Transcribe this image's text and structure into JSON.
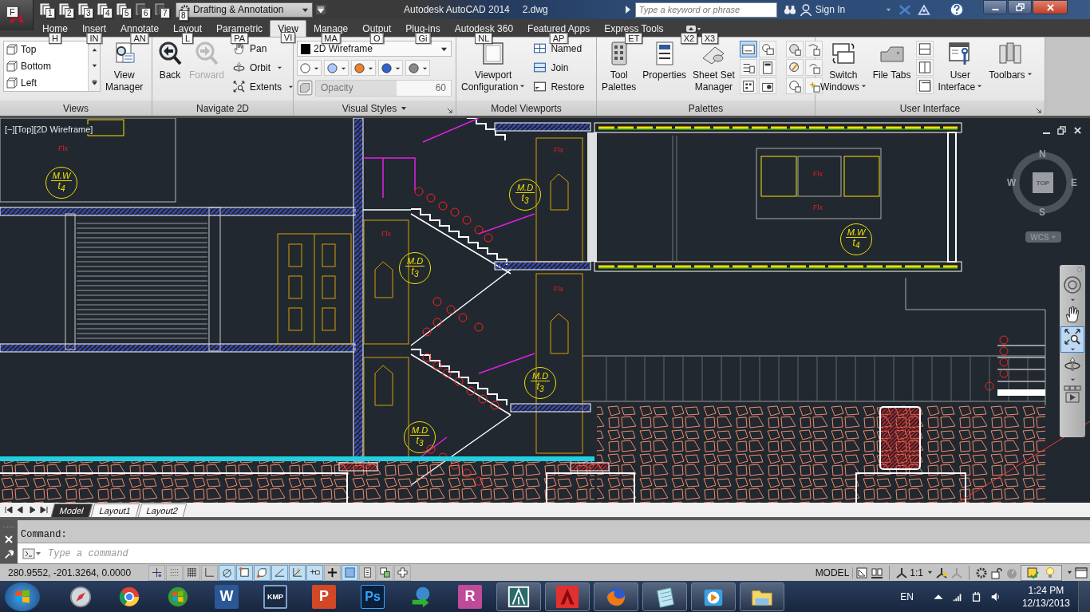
{
  "app_menu": {
    "keytip": "F"
  },
  "quick_access": [
    {
      "keytip": "1",
      "disabled": false
    },
    {
      "keytip": "2",
      "disabled": false
    },
    {
      "keytip": "3",
      "disabled": false
    },
    {
      "keytip": "4",
      "disabled": false
    },
    {
      "keytip": "5",
      "disabled": false
    },
    {
      "keytip": "6",
      "disabled": true
    },
    {
      "keytip": "7",
      "disabled": true
    }
  ],
  "workspace": {
    "label": "Drafting & Annotation",
    "keytip": "8"
  },
  "window": {
    "app_name": "Autodesk AutoCAD 2014",
    "file_name": "2.dwg"
  },
  "search": {
    "placeholder": "Type a keyword or phrase"
  },
  "sign_in": "Sign In",
  "tabs": [
    {
      "label": "Home",
      "keytip": "H",
      "selected": false
    },
    {
      "label": "Insert",
      "keytip": "IN",
      "selected": false
    },
    {
      "label": "Annotate",
      "keytip": "AN",
      "selected": false
    },
    {
      "label": "Layout",
      "keytip": "L",
      "selected": false
    },
    {
      "label": "Parametric",
      "keytip": "PA",
      "selected": false
    },
    {
      "label": "View",
      "keytip": "VI",
      "selected": true
    },
    {
      "label": "Manage",
      "keytip": "MA",
      "selected": false
    },
    {
      "label": "Output",
      "keytip": "O",
      "selected": false
    },
    {
      "label": "Plug-ins",
      "keytip": "Gi",
      "selected": false
    },
    {
      "label": "Autodesk 360",
      "keytip": "NL",
      "selected": false
    },
    {
      "label": "Featured Apps",
      "keytip": "AP",
      "selected": false
    },
    {
      "label": "Express Tools",
      "keytip": "ET",
      "selected": false
    }
  ],
  "ribbon_toggle": {
    "keytips": [
      "X2",
      "X3"
    ]
  },
  "panels": [
    {
      "kind": "views",
      "title": "Views",
      "menu": false,
      "launcher": false,
      "list": [
        {
          "label": "Top"
        },
        {
          "label": "Bottom"
        },
        {
          "label": "Left"
        }
      ],
      "large": [
        {
          "label": "View\nManager",
          "kind": "manager",
          "disabled": false,
          "dropdown": false
        }
      ]
    },
    {
      "kind": "navigate",
      "title": "Navigate 2D",
      "menu": false,
      "launcher": false,
      "large": [
        {
          "label": "Back",
          "kind": "back",
          "disabled": false,
          "dropdown": false
        },
        {
          "label": "Forward",
          "kind": "forward",
          "disabled": true,
          "dropdown": false
        }
      ],
      "small": [
        {
          "label": "Pan",
          "kind": "hand",
          "dropdown": false
        },
        {
          "label": "Orbit",
          "kind": "orbit",
          "dropdown": true
        },
        {
          "label": "Extents",
          "kind": "extents",
          "dropdown": true
        }
      ]
    },
    {
      "kind": "styles",
      "title": "Visual Styles",
      "menu": true,
      "launcher": true,
      "style": "2D Wireframe",
      "opacity": {
        "placeholder": "Opacity",
        "value": "60",
        "level": 0.6
      }
    },
    {
      "kind": "viewports",
      "title": "Model Viewports",
      "menu": false,
      "launcher": false,
      "large": [
        {
          "label": "Viewport\nConfiguration",
          "kind": "viewport",
          "disabled": false,
          "dropdown": true
        }
      ],
      "small": [
        {
          "label": "Named",
          "kind": "named",
          "dropdown": false
        },
        {
          "label": "Join",
          "kind": "join",
          "dropdown": false
        },
        {
          "label": "Restore",
          "kind": "restore",
          "dropdown": false
        }
      ]
    },
    {
      "kind": "palettes",
      "title": "Palettes",
      "menu": false,
      "launcher": false,
      "large": [
        {
          "label": "Tool\nPalettes",
          "kind": "palettes",
          "disabled": false,
          "dropdown": false
        },
        {
          "label": "Properties",
          "kind": "properties",
          "disabled": false,
          "dropdown": false
        },
        {
          "label": "Sheet Set\nManager",
          "kind": "sheetset",
          "disabled": false,
          "dropdown": false
        }
      ],
      "toggles": [
        {
          "on": true
        },
        {
          "on": false
        },
        {
          "on": false
        },
        {
          "on": false
        },
        {
          "on": false
        },
        {
          "on": false
        },
        {
          "on": false
        },
        {
          "on": false
        },
        {
          "on": false
        },
        {
          "on": false
        },
        {
          "on": false
        },
        {
          "on": false
        }
      ]
    },
    {
      "kind": "interface",
      "title": "User Interface",
      "menu": false,
      "launcher": true,
      "large": [
        {
          "label": "Switch\nWindows",
          "kind": "switch",
          "disabled": false,
          "dropdown": true
        },
        {
          "label": "File Tabs",
          "kind": "filetabs",
          "disabled": false,
          "dropdown": false
        },
        {
          "label": "User\nInterface",
          "kind": "ui",
          "disabled": false,
          "dropdown": true
        },
        {
          "label": "Toolbars",
          "kind": "toolbars",
          "disabled": false,
          "dropdown": true
        }
      ]
    }
  ],
  "viewport": {
    "label": "[−][Top][2D Wireframe]"
  },
  "viewcube": {
    "north": "N",
    "south": "S",
    "east": "E",
    "west": "W",
    "face": "TOP",
    "ucs": "WCS"
  },
  "annotations": [
    {
      "kind": "fix",
      "label": "Flx"
    },
    {
      "kind": "fix",
      "label": "Flx"
    },
    {
      "kind": "fix",
      "label": "Flx"
    },
    {
      "kind": "tag",
      "label": "M.W",
      "sub": "t$_{4}$"
    },
    {
      "kind": "tag",
      "label": "M.D",
      "sub": "t$_{3}$"
    },
    {
      "kind": "fix",
      "label": "Flx"
    },
    {
      "kind": "fix",
      "label": "Flx"
    },
    {
      "kind": "tag",
      "label": "M.W",
      "sub": "t$_{4}$"
    },
    {
      "kind": "tag",
      "label": "M.D",
      "sub": "t$_{3}$"
    },
    {
      "kind": "fix",
      "label": "Flx"
    },
    {
      "kind": "tag",
      "label": "M.D",
      "sub": "t$_{3}$"
    },
    {
      "kind": "tag",
      "label": "M.D",
      "sub": "t$_{3}$"
    }
  ],
  "layout_tabs": [
    {
      "label": "Model",
      "selected": true
    },
    {
      "label": "Layout1",
      "selected": false
    },
    {
      "label": "Layout2",
      "selected": false
    }
  ],
  "command": {
    "history": "Command:",
    "placeholder": "Type a command"
  },
  "status_bar": {
    "coordinates": "280.9552, -201.3264, 0.0000",
    "toggles": [
      {
        "on": false
      },
      {
        "on": false
      },
      {
        "on": false
      },
      {
        "on": false
      },
      {
        "on": true
      },
      {
        "on": true
      },
      {
        "on": true
      },
      {
        "on": true
      },
      {
        "on": true
      },
      {
        "on": true
      },
      {
        "on": false
      },
      {
        "on": true
      },
      {
        "on": false
      },
      {
        "on": false
      },
      {
        "on": false
      }
    ],
    "space": "MODEL",
    "scale": "1:1"
  },
  "taskbar": {
    "items": [
      {
        "kind": "compass",
        "running": false
      },
      {
        "kind": "ball",
        "running": false
      },
      {
        "kind": "flag",
        "running": false
      },
      {
        "kind": "doc",
        "glyph": "W",
        "running": false
      },
      {
        "kind": "player",
        "glyph": "KMP",
        "running": false
      },
      {
        "kind": "slides",
        "glyph": "P",
        "running": false
      },
      {
        "kind": "photo",
        "glyph": "Ps",
        "running": false
      },
      {
        "kind": "globe",
        "running": false
      },
      {
        "kind": "cube",
        "glyph": "R",
        "running": false
      },
      {
        "kind": "drafting",
        "running": true
      },
      {
        "kind": "cad",
        "running": true
      },
      {
        "kind": "fox",
        "running": true
      },
      {
        "kind": "notepad",
        "running": true
      },
      {
        "kind": "play",
        "running": true
      },
      {
        "kind": "folder",
        "running": true
      }
    ],
    "language": "EN",
    "time": "1:24 PM",
    "date": "12/13/2013"
  }
}
